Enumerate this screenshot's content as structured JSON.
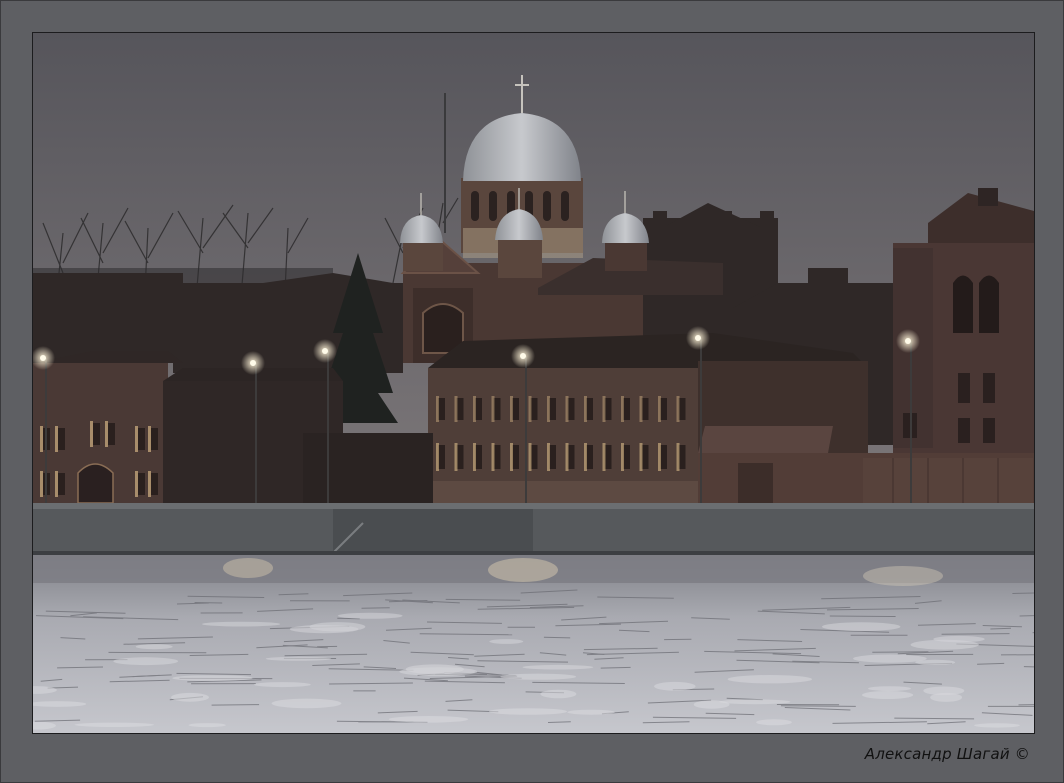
{
  "photo": {
    "subject": "night-lit-church-and-brick-buildings-on-frozen-river-embankment",
    "palette": {
      "sky_top": "#56555b",
      "sky_bottom": "#7a7678",
      "building_dark": "#3a2e2c",
      "building_mid": "#4d3b37",
      "window_glow": "#e8c690",
      "embankment": "#54575a",
      "ice_light": "#c9cacf",
      "ice_dark": "#6b6c73"
    }
  },
  "credit": {
    "text": "Александр Шагай ©"
  }
}
